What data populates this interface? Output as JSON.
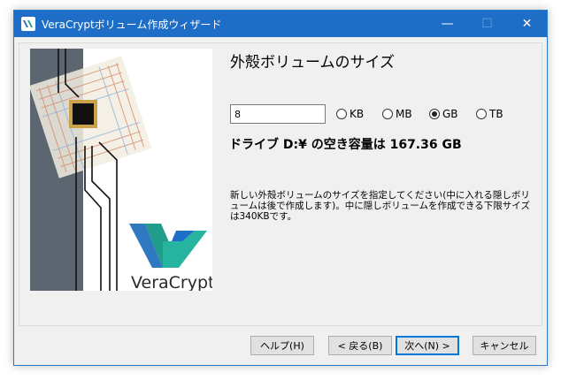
{
  "window": {
    "title": "VeraCryptボリューム作成ウィザード",
    "controls": {
      "minimize": "—",
      "maximize": "☐",
      "close": "✕"
    }
  },
  "side_image": {
    "brand": "VeraCrypt"
  },
  "page": {
    "title": "外殻ボリュームのサイズ",
    "size_value": "8",
    "units": [
      {
        "label": "KB",
        "selected": false
      },
      {
        "label": "MB",
        "selected": false
      },
      {
        "label": "GB",
        "selected": true
      },
      {
        "label": "TB",
        "selected": false
      }
    ],
    "free_space": "ドライブ D:¥ の空き容量は 167.36 GB",
    "help_text": "新しい外殻ボリュームのサイズを指定してください(中に入れる隠しボリュームは後で作成します)。中に隠しボリュームを作成できる下限サイズは340KBです。"
  },
  "buttons": {
    "help": "ヘルプ(H)",
    "back": "< 戻る(B)",
    "next": "次へ(N) >",
    "cancel": "キャンセル"
  },
  "colors": {
    "titlebar": "#1e6ec8",
    "dialog_bg": "#f0f0f0",
    "brand_teal": "#1f9c8a"
  }
}
